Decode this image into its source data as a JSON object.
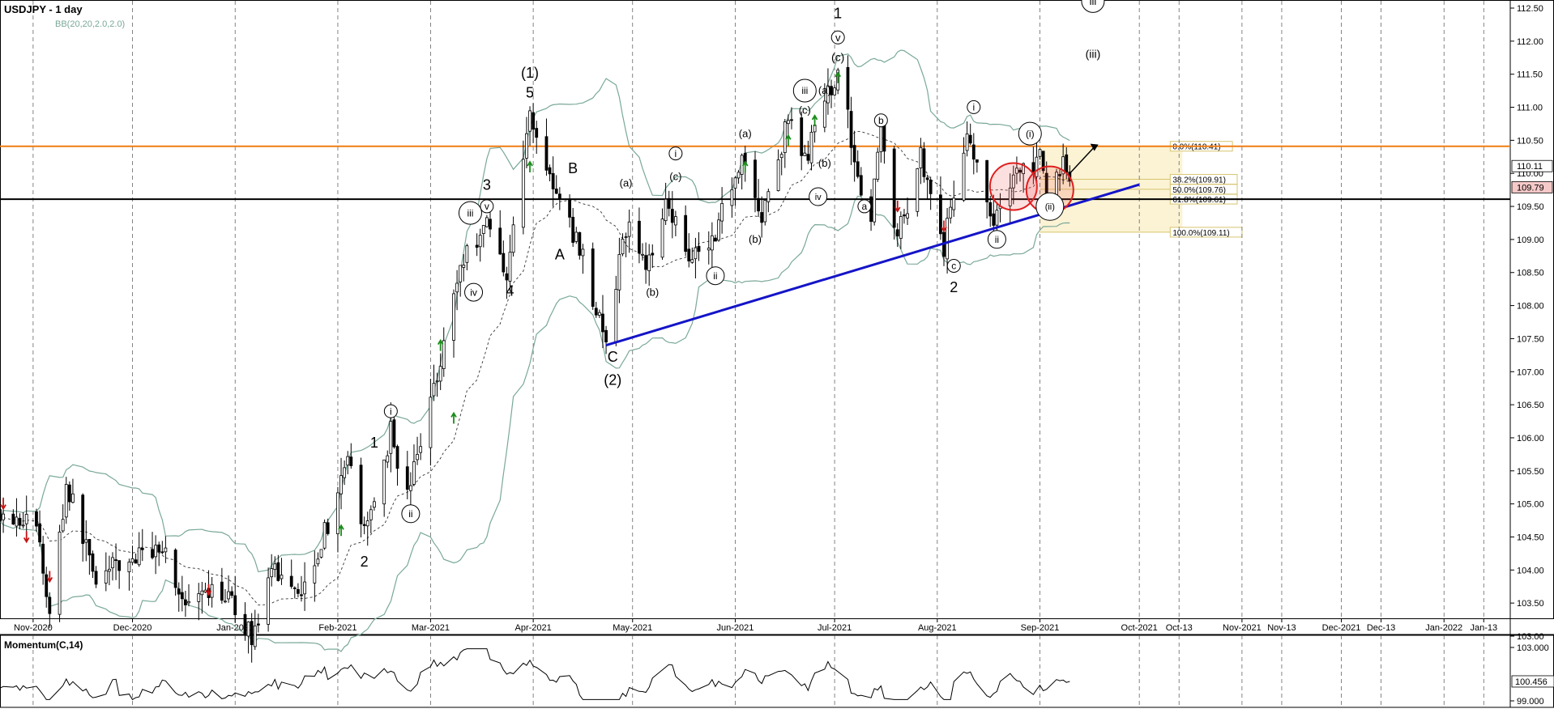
{
  "chart_title": "USDJPY - 1 day",
  "indicator_label": "BB(20,20,2.0,2.0)",
  "momentum_label": "Momentum(C,14)",
  "colors": {
    "candle": "#000000",
    "bollinger": "#7aa89a",
    "sma": "#333333",
    "resistance": "#f07d14",
    "support": "#000000",
    "trendline": "#1414c8",
    "fib_zone": "#fbf3d4",
    "fib_line": "#d7c46e",
    "circle": "#e01e1e",
    "last_price_tag": "#f6c9c9",
    "buy_arrow": "#1a8c1a",
    "sell_arrow": "#c81414"
  },
  "chart_data": {
    "type": "candlestick",
    "price_axis": {
      "min": 103.0,
      "max": 112.5,
      "ticks": [
        "112.50",
        "112.00",
        "111.50",
        "111.00",
        "110.50",
        "110.00",
        "109.50",
        "109.00",
        "108.50",
        "108.00",
        "107.50",
        "107.00",
        "106.50",
        "106.00",
        "105.50",
        "105.00",
        "104.50",
        "104.00",
        "103.50",
        "103.00"
      ]
    },
    "momentum_axis": {
      "min": 99.0,
      "max": 103.0,
      "ticks": [
        "103.000",
        "99.000"
      ]
    },
    "date_axis": {
      "start": "2020-10-22",
      "end": "2022-01-21",
      "labels": [
        {
          "text": "Nov-2020",
          "date": "2020-11-01"
        },
        {
          "text": "Dec-2020",
          "date": "2020-12-01"
        },
        {
          "text": "Jan-2021",
          "date": "2021-01-01"
        },
        {
          "text": "Feb-2021",
          "date": "2021-02-01"
        },
        {
          "text": "Mar-2021",
          "date": "2021-03-01"
        },
        {
          "text": "Apr-2021",
          "date": "2021-04-01"
        },
        {
          "text": "May-2021",
          "date": "2021-05-01"
        },
        {
          "text": "Jun-2021",
          "date": "2021-06-01"
        },
        {
          "text": "Jul-2021",
          "date": "2021-07-01"
        },
        {
          "text": "Aug-2021",
          "date": "2021-08-01"
        },
        {
          "text": "Sep-2021",
          "date": "2021-09-01"
        },
        {
          "text": "Oct-2021",
          "date": "2021-10-01"
        },
        {
          "text": "Oct-13",
          "date": "2021-10-13"
        },
        {
          "text": "Nov-2021",
          "date": "2021-11-01"
        },
        {
          "text": "Nov-13",
          "date": "2021-11-13"
        },
        {
          "text": "Dec-2021",
          "date": "2021-12-01"
        },
        {
          "text": "Dec-13",
          "date": "2021-12-13"
        },
        {
          "text": "Jan-2022",
          "date": "2022-01-01"
        },
        {
          "text": "Jan-13",
          "date": "2022-01-13"
        }
      ]
    },
    "price_path": [
      [
        "2020-10-22",
        104.9
      ],
      [
        "2020-11-02",
        104.7
      ],
      [
        "2020-11-06",
        103.3
      ],
      [
        "2020-11-11",
        105.3
      ],
      [
        "2020-11-20",
        103.9
      ],
      [
        "2020-12-03",
        104.2
      ],
      [
        "2020-12-10",
        104.4
      ],
      [
        "2020-12-17",
        103.4
      ],
      [
        "2020-12-28",
        103.7
      ],
      [
        "2021-01-06",
        103.0
      ],
      [
        "2021-01-13",
        104.0
      ],
      [
        "2021-01-21",
        103.7
      ],
      [
        "2021-01-29",
        104.7
      ],
      [
        "2021-02-05",
        105.7
      ],
      [
        "2021-02-09",
        104.5
      ],
      [
        "2021-02-17",
        106.1
      ],
      [
        "2021-02-22",
        105.1
      ],
      [
        "2021-03-03",
        107.0
      ],
      [
        "2021-03-10",
        108.6
      ],
      [
        "2021-03-18",
        109.3
      ],
      [
        "2021-03-24",
        108.5
      ],
      [
        "2021-03-31",
        110.9
      ],
      [
        "2021-04-09",
        109.5
      ],
      [
        "2021-04-15",
        108.9
      ],
      [
        "2021-04-23",
        107.4
      ],
      [
        "2021-04-29",
        109.2
      ],
      [
        "2021-05-06",
        108.6
      ],
      [
        "2021-05-11",
        109.7
      ],
      [
        "2021-05-17",
        108.8
      ],
      [
        "2021-05-25",
        109.0
      ],
      [
        "2021-06-03",
        110.3
      ],
      [
        "2021-06-09",
        109.3
      ],
      [
        "2021-06-17",
        110.8
      ],
      [
        "2021-06-22",
        110.2
      ],
      [
        "2021-07-02",
        111.6
      ],
      [
        "2021-07-08",
        110.0
      ],
      [
        "2021-07-12",
        109.3
      ],
      [
        "2021-07-15",
        110.7
      ],
      [
        "2021-07-20",
        109.0
      ],
      [
        "2021-07-27",
        110.3
      ],
      [
        "2021-08-03",
        108.9
      ],
      [
        "2021-08-10",
        110.7
      ],
      [
        "2021-08-17",
        109.2
      ],
      [
        "2021-08-24",
        110.0
      ],
      [
        "2021-08-30",
        110.1
      ],
      [
        "2021-09-01",
        110.2
      ],
      [
        "2021-09-03",
        109.6
      ],
      [
        "2021-09-08",
        110.2
      ],
      [
        "2021-09-10",
        109.9
      ]
    ],
    "resistance": {
      "value": 110.41
    },
    "support": {
      "value": 109.61
    },
    "trendline": {
      "from": [
        "2021-04-23",
        107.4
      ],
      "to": [
        "2021-10-01",
        109.83
      ]
    },
    "projection_arrow": {
      "from": [
        "2021-09-10",
        110.0
      ],
      "to": [
        "2021-09-14",
        110.35
      ]
    },
    "fibonacci": {
      "start": "2021-09-01",
      "end": "2021-10-14",
      "levels": [
        {
          "label": "0.0%(110.41)",
          "value": 110.41
        },
        {
          "label": "38.2%(109.91)",
          "value": 109.91
        },
        {
          "label": "50.0%(109.76)",
          "value": 109.76
        },
        {
          "label": "61.8%(109.61)",
          "value": 109.61
        },
        {
          "label": "100.0%(109.11)",
          "value": 109.11
        }
      ]
    },
    "price_tags": [
      {
        "label": "110.11",
        "value": 110.11,
        "style": "plain"
      },
      {
        "label": "109.79",
        "value": 109.79,
        "style": "highlight"
      }
    ],
    "momentum_current": {
      "label": "100.456",
      "value": 100.456
    },
    "circles": [
      {
        "date": "2021-08-24",
        "value": 109.8
      },
      {
        "date": "2021-09-04",
        "value": 109.75
      }
    ],
    "buy_signals": [
      {
        "date": "2021-02-02",
        "value": 104.6
      },
      {
        "date": "2021-03-04",
        "value": 107.4
      },
      {
        "date": "2021-03-08",
        "value": 106.3
      },
      {
        "date": "2021-03-31",
        "value": 110.1
      },
      {
        "date": "2021-06-04",
        "value": 110.1
      },
      {
        "date": "2021-06-17",
        "value": 110.5
      },
      {
        "date": "2021-06-25",
        "value": 110.8
      },
      {
        "date": "2021-07-02",
        "value": 111.45
      }
    ],
    "sell_signals": [
      {
        "date": "2020-10-23",
        "value": 105.0
      },
      {
        "date": "2020-10-30",
        "value": 104.5
      },
      {
        "date": "2020-11-06",
        "value": 103.9
      },
      {
        "date": "2020-12-24",
        "value": 103.7
      },
      {
        "date": "2021-07-20",
        "value": 109.5
      },
      {
        "date": "2021-08-03",
        "value": 109.2
      }
    ],
    "wave_labels": [
      {
        "text": "(1)",
        "date": "2021-03-31",
        "value": 111.45,
        "circled": false,
        "size": 18
      },
      {
        "text": "5",
        "date": "2021-03-31",
        "value": 111.15,
        "circled": false,
        "size": 18
      },
      {
        "text": "1",
        "date": "2021-07-02",
        "value": 112.35,
        "circled": false,
        "size": 18
      },
      {
        "text": "v",
        "date": "2021-07-02",
        "value": 112.0,
        "circled": true,
        "size": 13
      },
      {
        "text": "(c)",
        "date": "2021-07-02",
        "value": 111.7,
        "circled": false,
        "size": 14
      },
      {
        "text": "iii",
        "date": "2021-09-17",
        "value": 112.55,
        "circled": true,
        "size": 13
      },
      {
        "text": "(iii)",
        "date": "2021-09-17",
        "value": 111.75,
        "circled": false,
        "size": 14
      },
      {
        "text": "iii",
        "date": "2021-06-22",
        "value": 111.2,
        "circled": true,
        "size": 12
      },
      {
        "text": "(a)",
        "date": "2021-06-28",
        "value": 111.2,
        "circled": false,
        "size": 13
      },
      {
        "text": "(c)",
        "date": "2021-06-22",
        "value": 110.9,
        "circled": false,
        "size": 13
      },
      {
        "text": "(b)",
        "date": "2021-06-28",
        "value": 110.1,
        "circled": false,
        "size": 13
      },
      {
        "text": "iv",
        "date": "2021-06-26",
        "value": 109.6,
        "circled": true,
        "size": 11
      },
      {
        "text": "b",
        "date": "2021-07-15",
        "value": 110.75,
        "circled": true,
        "size": 12
      },
      {
        "text": "a",
        "date": "2021-07-10",
        "value": 109.45,
        "circled": true,
        "size": 12
      },
      {
        "text": "i",
        "date": "2021-08-12",
        "value": 110.95,
        "circled": true,
        "size": 12
      },
      {
        "text": "(i)",
        "date": "2021-08-29",
        "value": 110.55,
        "circled": true,
        "size": 12
      },
      {
        "text": "(ii)",
        "date": "2021-09-04",
        "value": 109.45,
        "circled": true,
        "size": 11
      },
      {
        "text": "ii",
        "date": "2021-08-19",
        "value": 108.95,
        "circled": true,
        "size": 12
      },
      {
        "text": "c",
        "date": "2021-08-06",
        "value": 108.55,
        "circled": true,
        "size": 12
      },
      {
        "text": "2",
        "date": "2021-08-06",
        "value": 108.2,
        "circled": false,
        "size": 18
      },
      {
        "text": "(a)",
        "date": "2021-06-04",
        "value": 110.55,
        "circled": false,
        "size": 13
      },
      {
        "text": "i",
        "date": "2021-05-14",
        "value": 110.25,
        "circled": true,
        "size": 12
      },
      {
        "text": "(c)",
        "date": "2021-05-14",
        "value": 109.9,
        "circled": false,
        "size": 13
      },
      {
        "text": "(a)",
        "date": "2021-04-29",
        "value": 109.8,
        "circled": false,
        "size": 13
      },
      {
        "text": "(b)",
        "date": "2021-06-07",
        "value": 108.95,
        "circled": false,
        "size": 13
      },
      {
        "text": "ii",
        "date": "2021-05-26",
        "value": 108.4,
        "circled": true,
        "size": 12
      },
      {
        "text": "(b)",
        "date": "2021-05-07",
        "value": 108.15,
        "circled": false,
        "size": 13
      },
      {
        "text": "B",
        "date": "2021-04-13",
        "value": 110.0,
        "circled": false,
        "size": 18
      },
      {
        "text": "A",
        "date": "2021-04-09",
        "value": 108.7,
        "circled": false,
        "size": 18
      },
      {
        "text": "C",
        "date": "2021-04-25",
        "value": 107.15,
        "circled": false,
        "size": 18
      },
      {
        "text": "(2)",
        "date": "2021-04-25",
        "value": 106.8,
        "circled": false,
        "size": 18
      },
      {
        "text": "3",
        "date": "2021-03-18",
        "value": 109.75,
        "circled": false,
        "size": 18
      },
      {
        "text": "v",
        "date": "2021-03-18",
        "value": 109.45,
        "circled": true,
        "size": 12
      },
      {
        "text": "iii",
        "date": "2021-03-13",
        "value": 109.35,
        "circled": true,
        "size": 12
      },
      {
        "text": "iv",
        "date": "2021-03-14",
        "value": 108.15,
        "circled": true,
        "size": 12
      },
      {
        "text": "4",
        "date": "2021-03-25",
        "value": 108.15,
        "circled": false,
        "size": 18
      },
      {
        "text": "i",
        "date": "2021-02-17",
        "value": 106.35,
        "circled": true,
        "size": 12
      },
      {
        "text": "1",
        "date": "2021-02-12",
        "value": 105.85,
        "circled": false,
        "size": 18
      },
      {
        "text": "ii",
        "date": "2021-02-23",
        "value": 104.8,
        "circled": true,
        "size": 12
      },
      {
        "text": "2",
        "date": "2021-02-09",
        "value": 104.05,
        "circled": false,
        "size": 18
      }
    ]
  }
}
